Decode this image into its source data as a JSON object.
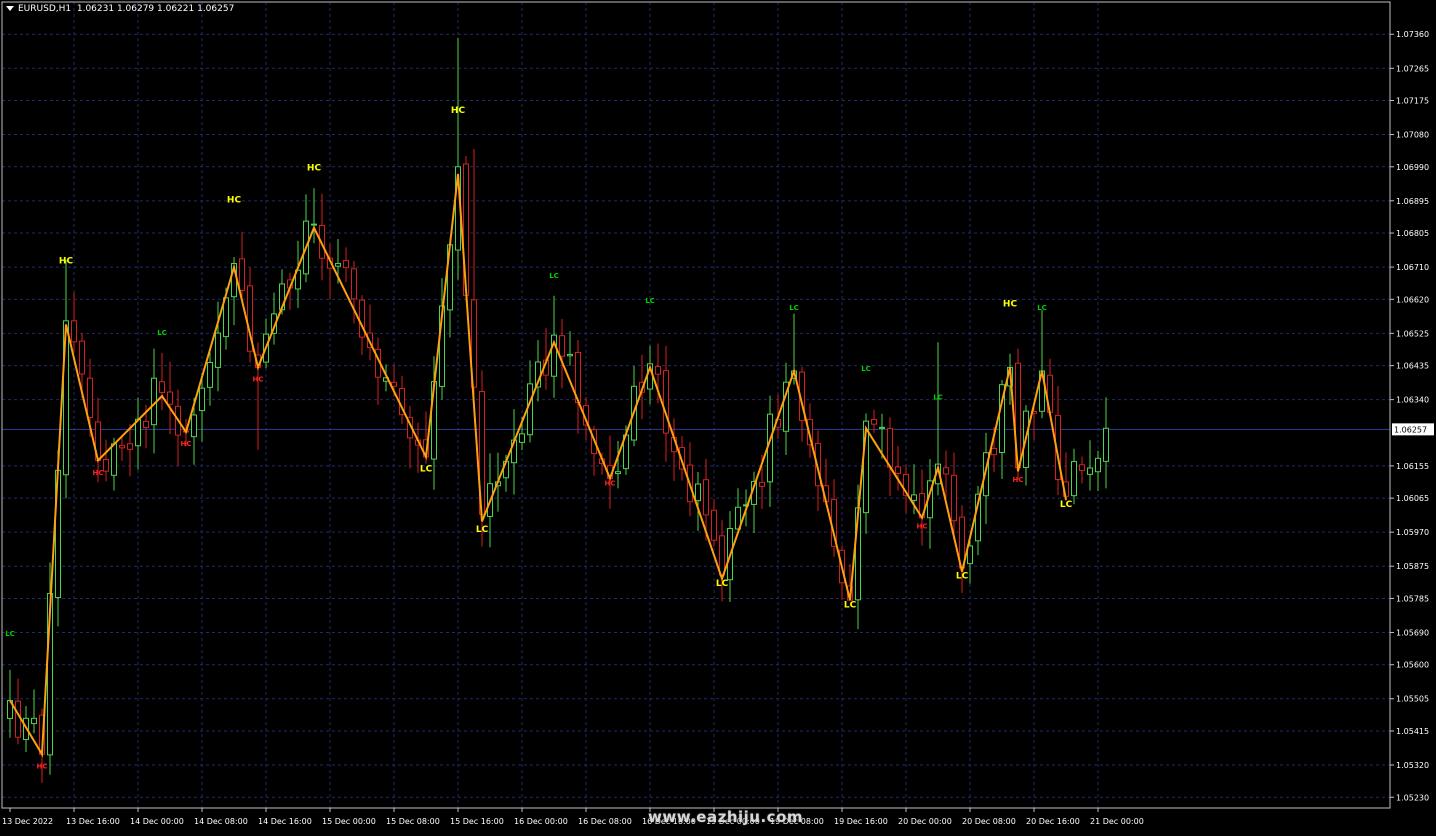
{
  "window": {
    "symbol": "EURUSD,H1",
    "ohlc": "1.06231 1.06279 1.06221 1.06257",
    "watermark": "www.eazhiju.com"
  },
  "colors": {
    "background": "#000000",
    "grid": "#1f2a6b",
    "frame": "#c0c0c0",
    "bull": "#4cd44c",
    "bear": "#d42020",
    "zigzag": "#ffa010",
    "label_yellow": "#ffff00",
    "label_green": "#00d000",
    "label_red": "#ff2020",
    "price_line": "#2a3f99",
    "axis_text": "#ffffff"
  },
  "chart_data": {
    "type": "candlestick",
    "symbol": "EURUSD",
    "timeframe": "H1",
    "current_price": "1.06257",
    "ylim": [
      1.052,
      1.0745
    ],
    "y_ticks": [
      "1.07360",
      "1.07265",
      "1.07175",
      "1.07080",
      "1.06990",
      "1.06895",
      "1.06805",
      "1.06710",
      "1.06620",
      "1.06525",
      "1.06435",
      "1.06340",
      "1.06155",
      "1.06065",
      "1.05970",
      "1.05875",
      "1.05785",
      "1.05690",
      "1.05600",
      "1.05505",
      "1.05415",
      "1.05320",
      "1.05230"
    ],
    "x_ticks": [
      {
        "label": "13 Dec 2022",
        "bar": 0
      },
      {
        "label": "13 Dec 16:00",
        "bar": 8
      },
      {
        "label": "14 Dec 00:00",
        "bar": 16
      },
      {
        "label": "14 Dec 08:00",
        "bar": 24
      },
      {
        "label": "14 Dec 16:00",
        "bar": 32
      },
      {
        "label": "15 Dec 00:00",
        "bar": 40
      },
      {
        "label": "15 Dec 08:00",
        "bar": 48
      },
      {
        "label": "15 Dec 16:00",
        "bar": 56
      },
      {
        "label": "16 Dec 00:00",
        "bar": 64
      },
      {
        "label": "16 Dec 08:00",
        "bar": 72
      },
      {
        "label": "16 Dec 16:00",
        "bar": 80
      },
      {
        "label": "19 Dec 00:00",
        "bar": 88
      },
      {
        "label": "19 Dec 08:00",
        "bar": 96
      },
      {
        "label": "19 Dec 16:00",
        "bar": 104
      },
      {
        "label": "20 Dec 00:00",
        "bar": 112
      },
      {
        "label": "20 Dec 08:00",
        "bar": 120
      },
      {
        "label": "20 Dec 16:00",
        "bar": 128
      },
      {
        "label": "21 Dec 00:00",
        "bar": 136
      }
    ],
    "anchors": [
      [
        0,
        1.055
      ],
      [
        4,
        1.0535
      ],
      [
        7,
        1.0656
      ],
      [
        11,
        1.0617
      ],
      [
        19,
        1.0636
      ],
      [
        22,
        1.0625
      ],
      [
        28,
        1.0672
      ],
      [
        31,
        1.0643
      ],
      [
        38,
        1.0683
      ],
      [
        52,
        1.0618
      ],
      [
        56,
        1.0699
      ],
      [
        59,
        1.0602
      ],
      [
        68,
        1.0652
      ],
      [
        75,
        1.0612
      ],
      [
        80,
        1.0644
      ],
      [
        89,
        1.0585
      ],
      [
        98,
        1.0642
      ],
      [
        105,
        1.0578
      ],
      [
        107,
        1.0628
      ],
      [
        114,
        1.0601
      ],
      [
        116,
        1.0616
      ],
      [
        119,
        1.0587
      ],
      [
        125,
        1.0643
      ],
      [
        126,
        1.0615
      ],
      [
        129,
        1.0642
      ],
      [
        132,
        1.0607
      ],
      [
        137,
        1.0626
      ]
    ],
    "zigzag": [
      [
        0,
        1.055
      ],
      [
        4,
        1.0535
      ],
      [
        7,
        1.0655
      ],
      [
        11,
        1.0617
      ],
      [
        19,
        1.0635
      ],
      [
        22,
        1.0625
      ],
      [
        28,
        1.0671
      ],
      [
        31,
        1.0643
      ],
      [
        38,
        1.0682
      ],
      [
        52,
        1.0618
      ],
      [
        56,
        1.0697
      ],
      [
        59,
        1.06
      ],
      [
        68,
        1.065
      ],
      [
        75,
        1.0612
      ],
      [
        80,
        1.0643
      ],
      [
        89,
        1.0584
      ],
      [
        98,
        1.0642
      ],
      [
        105,
        1.0578
      ],
      [
        107,
        1.0626
      ],
      [
        114,
        1.0601
      ],
      [
        116,
        1.0615
      ],
      [
        119,
        1.0586
      ],
      [
        125,
        1.0643
      ],
      [
        126,
        1.0614
      ],
      [
        129,
        1.0642
      ],
      [
        132,
        1.0606
      ]
    ],
    "labels": [
      {
        "text": "LC",
        "bar": 0,
        "price": 1.0568,
        "color": "green"
      },
      {
        "text": "HC",
        "bar": 4,
        "price": 1.0531,
        "color": "red"
      },
      {
        "text": "HC",
        "bar": 7,
        "price": 1.0672,
        "color": "yellow"
      },
      {
        "text": "HC",
        "bar": 11,
        "price": 1.0613,
        "color": "red"
      },
      {
        "text": "LC",
        "bar": 19,
        "price": 1.0652,
        "color": "green"
      },
      {
        "text": "HC",
        "bar": 22,
        "price": 1.0621,
        "color": "red"
      },
      {
        "text": "HC",
        "bar": 28,
        "price": 1.0689,
        "color": "yellow"
      },
      {
        "text": "HC",
        "bar": 31,
        "price": 1.0639,
        "color": "red"
      },
      {
        "text": "HC",
        "bar": 38,
        "price": 1.0698,
        "color": "yellow"
      },
      {
        "text": "LC",
        "bar": 52,
        "price": 1.0614,
        "color": "yellow"
      },
      {
        "text": "HC",
        "bar": 56,
        "price": 1.0714,
        "color": "yellow"
      },
      {
        "text": "LC",
        "bar": 59,
        "price": 1.0597,
        "color": "yellow"
      },
      {
        "text": "LC",
        "bar": 68,
        "price": 1.0668,
        "color": "green"
      },
      {
        "text": "HC",
        "bar": 75,
        "price": 1.061,
        "color": "red"
      },
      {
        "text": "LC",
        "bar": 80,
        "price": 1.0661,
        "color": "green"
      },
      {
        "text": "LC",
        "bar": 89,
        "price": 1.0582,
        "color": "yellow"
      },
      {
        "text": "LC",
        "bar": 98,
        "price": 1.0659,
        "color": "green"
      },
      {
        "text": "LC",
        "bar": 105,
        "price": 1.0576,
        "color": "yellow"
      },
      {
        "text": "LC",
        "bar": 107,
        "price": 1.0642,
        "color": "green"
      },
      {
        "text": "HC",
        "bar": 114,
        "price": 1.0598,
        "color": "red"
      },
      {
        "text": "LC",
        "bar": 116,
        "price": 1.0634,
        "color": "green"
      },
      {
        "text": "LC",
        "bar": 119,
        "price": 1.0584,
        "color": "yellow"
      },
      {
        "text": "HC",
        "bar": 125,
        "price": 1.066,
        "color": "yellow"
      },
      {
        "text": "HC",
        "bar": 126,
        "price": 1.0611,
        "color": "red"
      },
      {
        "text": "LC",
        "bar": 129,
        "price": 1.0659,
        "color": "green"
      },
      {
        "text": "LC",
        "bar": 132,
        "price": 1.0604,
        "color": "yellow"
      }
    ],
    "spikes": [
      {
        "bar": 56,
        "high": 1.0735
      },
      {
        "bar": 58,
        "high": 1.0704
      },
      {
        "bar": 7,
        "high": 1.0673
      },
      {
        "bar": 129,
        "high": 1.0659
      },
      {
        "bar": 98,
        "high": 1.0658
      },
      {
        "bar": 68,
        "high": 1.0663
      },
      {
        "bar": 116,
        "high": 1.065
      },
      {
        "bar": 38,
        "high": 1.0693
      },
      {
        "bar": 4,
        "low": 1.0527
      },
      {
        "bar": 105,
        "low": 1.0578
      },
      {
        "bar": 119,
        "low": 1.058
      },
      {
        "bar": 59,
        "low": 1.0593
      },
      {
        "bar": 31,
        "low": 1.062
      }
    ]
  }
}
